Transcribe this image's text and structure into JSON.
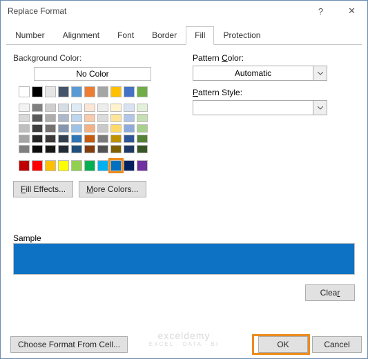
{
  "window": {
    "title": "Replace Format",
    "help_glyph": "?",
    "close_glyph": "✕"
  },
  "tabs": {
    "number": "Number",
    "alignment": "Alignment",
    "font": "Font",
    "border": "Border",
    "fill": "Fill",
    "protection": "Protection"
  },
  "fill": {
    "bg_label": "Background Color:",
    "no_color": "No Color",
    "fill_effects": "Fill Effects...",
    "more_colors": "More Colors...",
    "pattern_color_label": "Pattern Color:",
    "pattern_color_value": "Automatic",
    "pattern_style_label": "Pattern Style:",
    "pattern_style_value": ""
  },
  "theme_palette": {
    "row0": [
      "#ffffff",
      "#000000",
      "#e7e6e6",
      "#44546a",
      "#5b9bd5",
      "#ed7d31",
      "#a5a5a5",
      "#ffc000",
      "#4472c4",
      "#70ad47"
    ],
    "shades": [
      [
        "#f2f2f2",
        "#7f7f7f",
        "#d0cece",
        "#d6dce4",
        "#deebf6",
        "#fbe5d5",
        "#ededed",
        "#fff2cc",
        "#d9e2f3",
        "#e2efd9"
      ],
      [
        "#d8d8d8",
        "#595959",
        "#aeabab",
        "#adb9ca",
        "#bdd7ee",
        "#f7cbac",
        "#dbdbdb",
        "#fee599",
        "#b4c6e7",
        "#c5e0b3"
      ],
      [
        "#bfbfbf",
        "#3f3f3f",
        "#757070",
        "#8496b0",
        "#9cc3e5",
        "#f4b183",
        "#c9c9c9",
        "#ffd965",
        "#8eaadb",
        "#a8d08d"
      ],
      [
        "#a5a5a5",
        "#262626",
        "#3a3838",
        "#323f4f",
        "#2e75b5",
        "#c55a11",
        "#7b7b7b",
        "#bf9000",
        "#2f5496",
        "#538135"
      ],
      [
        "#7f7f7f",
        "#0c0c0c",
        "#171616",
        "#222a35",
        "#1e4e79",
        "#833c0b",
        "#525252",
        "#7f6000",
        "#1f3864",
        "#375623"
      ]
    ],
    "standard": [
      "#c00000",
      "#ff0000",
      "#ffc000",
      "#ffff00",
      "#92d050",
      "#00b050",
      "#00b0f0",
      "#0070c0",
      "#002060",
      "#7030a0"
    ],
    "selected_index": 7
  },
  "sample": {
    "label": "Sample",
    "color": "#0e72c4"
  },
  "buttons": {
    "clear": "Clear",
    "choose_format": "Choose Format From Cell...",
    "ok": "OK",
    "cancel": "Cancel"
  },
  "watermark": {
    "main": "exceldemy",
    "sub": "EXCEL · DATA · BI"
  }
}
